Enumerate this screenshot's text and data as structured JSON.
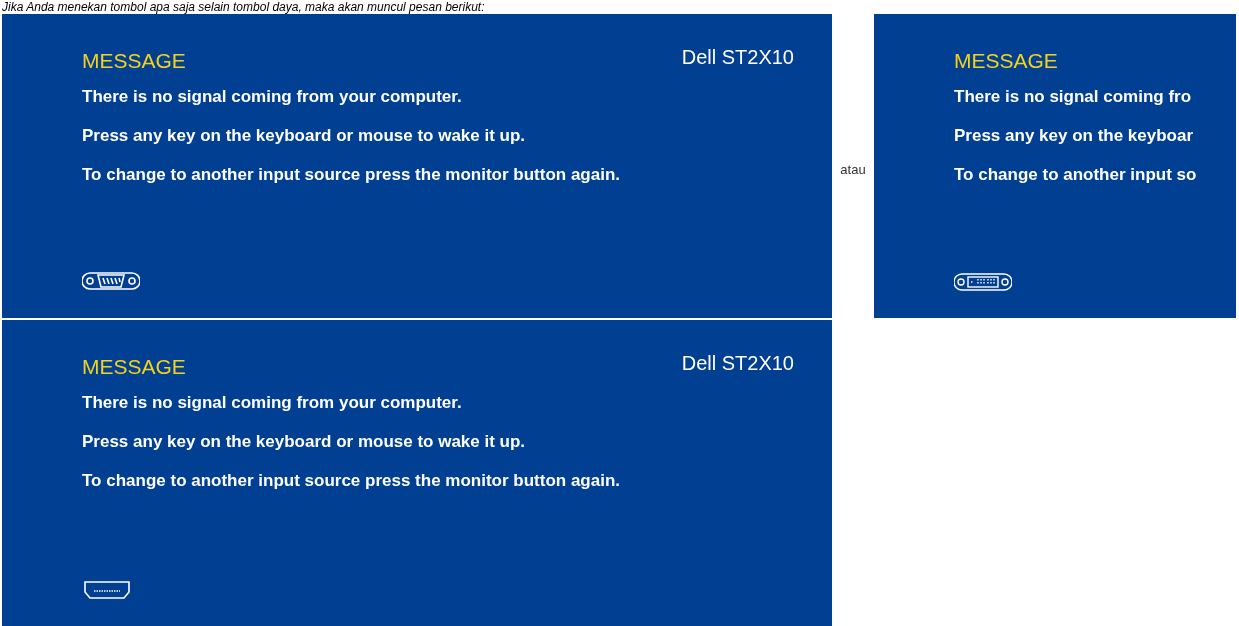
{
  "intro": "Jika Anda menekan tombol apa saja selain tombol daya, maka akan muncul pesan berikut:",
  "separator": "atau",
  "panels": [
    {
      "title": "MESSAGE",
      "model": "Dell ST2X10",
      "lines": [
        "There is no signal coming from your computer.",
        "Press any key on the keyboard or mouse to wake it up.",
        "To change to another input source press the monitor button again."
      ],
      "kind": "vga"
    },
    {
      "title": "MESSAGE",
      "lines": [
        "There is no signal coming fro",
        "Press any key on the keyboar",
        "To change to another input so"
      ],
      "kind": "dvi"
    },
    {
      "title": "MESSAGE",
      "model": "Dell ST2X10",
      "lines": [
        "There is no signal coming from your computer.",
        "Press any key on the keyboard or mouse to wake it up.",
        "To change to another input source press the monitor button again."
      ],
      "kind": "hdmi"
    }
  ]
}
